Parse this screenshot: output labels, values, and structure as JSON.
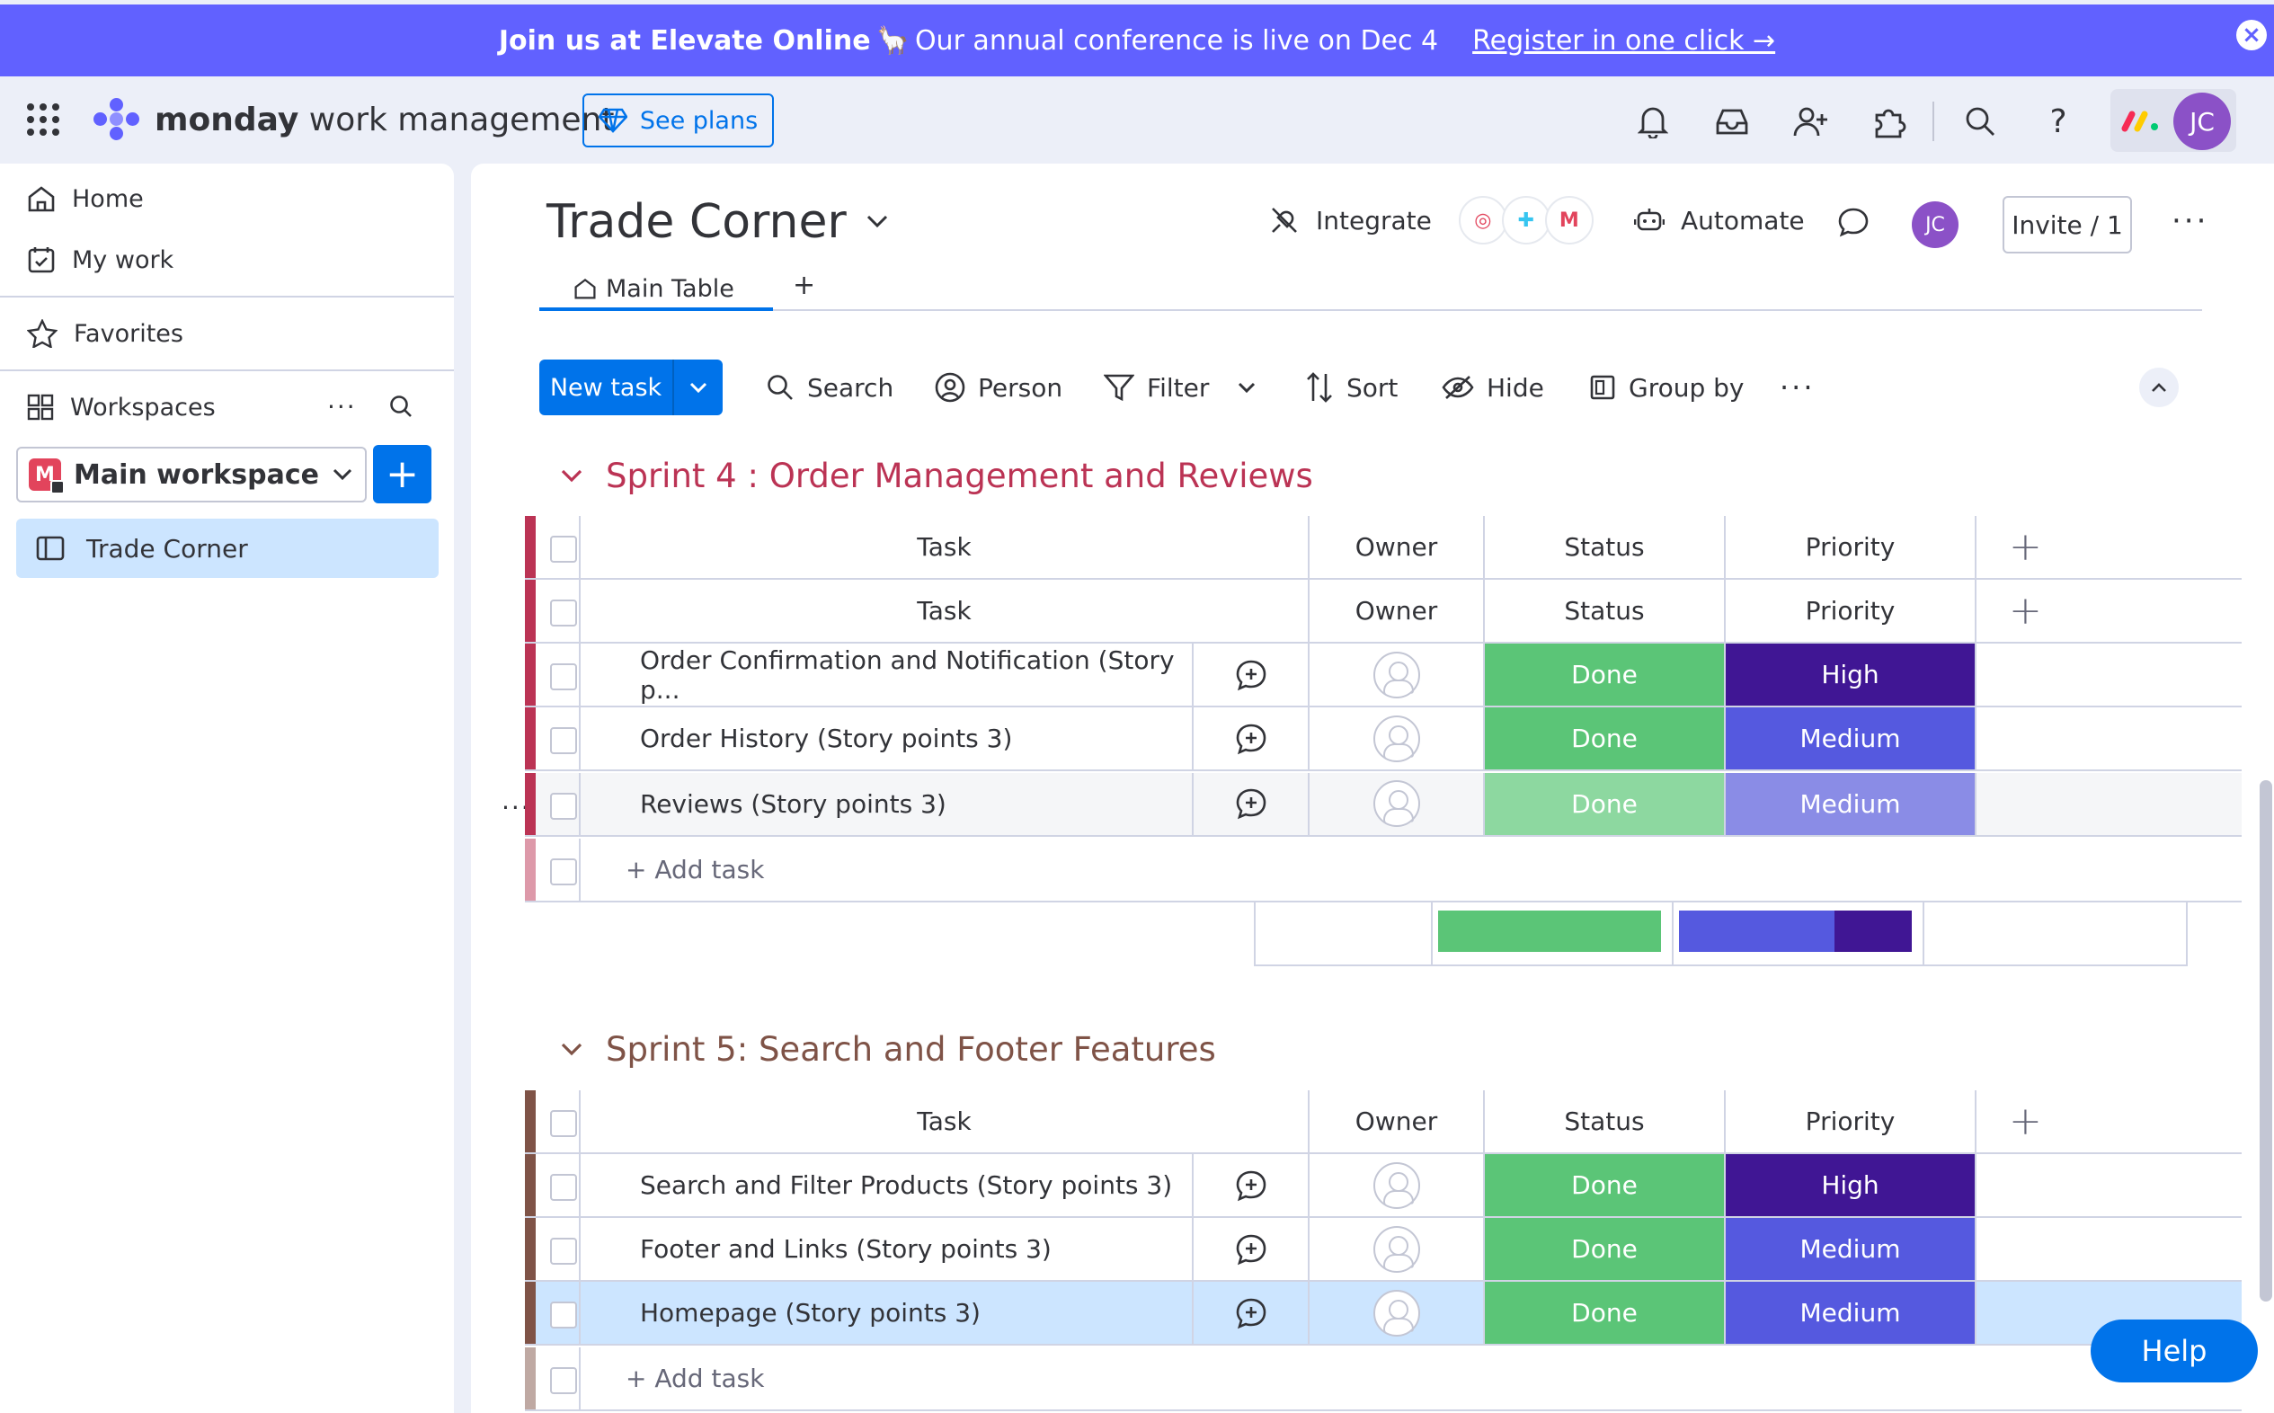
{
  "banner": {
    "bold_text": "Join us at Elevate Online",
    "emoji": "🦙",
    "text": "Our annual conference is live on Dec 4",
    "link": "Register in one click →",
    "close_icon": "close-icon"
  },
  "topbar": {
    "brand_bold": "monday",
    "brand_rest": "work management",
    "see_plans": "See plans",
    "user_initials": "JC"
  },
  "sidebar": {
    "home": "Home",
    "my_work": "My work",
    "favorites": "Favorites",
    "workspaces": "Workspaces",
    "workspace_badge": "M",
    "workspace_name": "Main workspace",
    "board_item": "Trade Corner"
  },
  "board": {
    "title": "Trade Corner",
    "integrate": "Integrate",
    "automate": "Automate",
    "user_initials": "JC",
    "invite": "Invite / 1",
    "tab_main": "Main Table",
    "tab_add": "+"
  },
  "toolbar": {
    "new_task": "New task",
    "search": "Search",
    "person": "Person",
    "filter": "Filter",
    "sort": "Sort",
    "hide": "Hide",
    "group_by": "Group by"
  },
  "columns": {
    "task": "Task",
    "owner": "Owner",
    "status": "Status",
    "priority": "Priority",
    "add": "+"
  },
  "groups": [
    {
      "title": "Sprint 4 : Order Management and Reviews",
      "color": "#bb3354",
      "add_task": "+ Add task",
      "rows": [
        {
          "task": "Order Confirmation and Notification (Story p...",
          "status": "Done",
          "priority": "High"
        },
        {
          "task": "Order History (Story points 3)",
          "status": "Done",
          "priority": "Medium"
        },
        {
          "task": "Reviews (Story points 3)",
          "status": "Done",
          "priority": "Medium"
        }
      ]
    },
    {
      "title": "Sprint 5: Search and Footer Features",
      "color": "#7f5347",
      "add_task": "+ Add task",
      "rows": [
        {
          "task": "Search and Filter Products (Story points 3)",
          "status": "Done",
          "priority": "High"
        },
        {
          "task": "Footer and Links (Story points 3)",
          "status": "Done",
          "priority": "Medium"
        },
        {
          "task": "Homepage (Story points 3)",
          "status": "Done",
          "priority": "Medium"
        }
      ]
    }
  ],
  "colors": {
    "done": "#5bc577",
    "high": "#401694",
    "medium": "#5559df",
    "accent": "#0073ea",
    "banner": "#6161ff"
  },
  "help": "Help"
}
